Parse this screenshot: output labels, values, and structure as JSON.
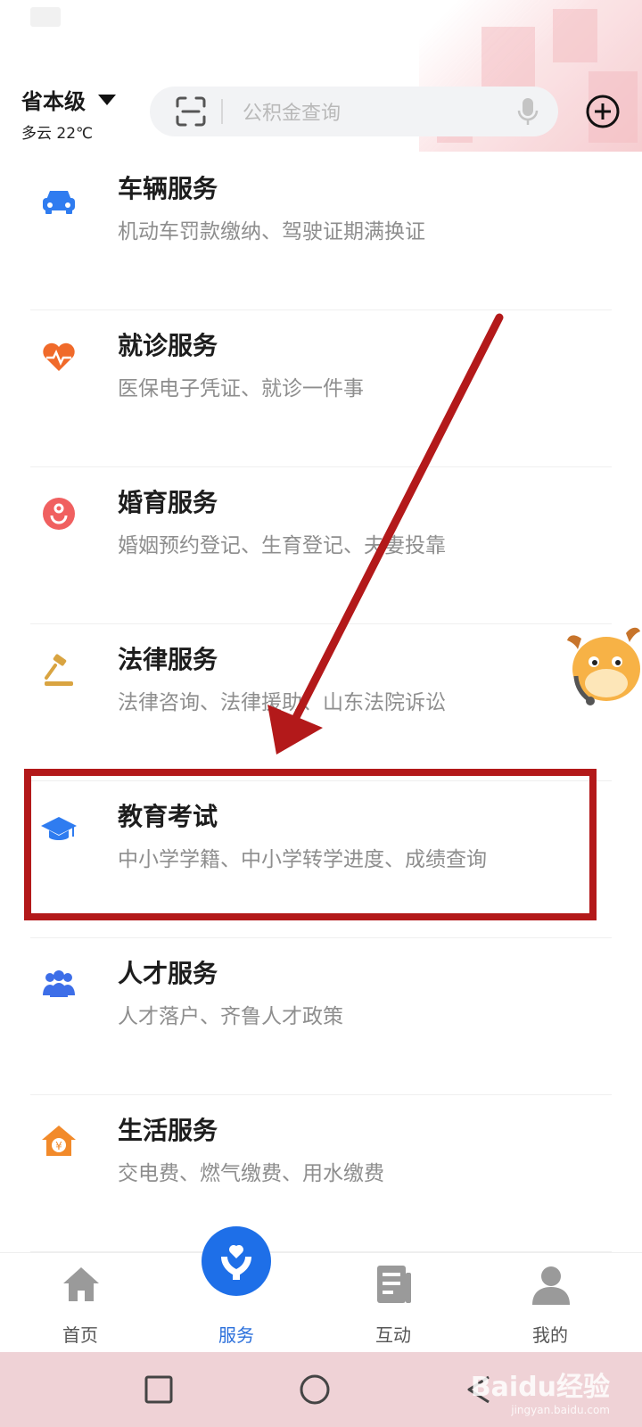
{
  "header": {
    "region": "省本级",
    "weather": "多云 22℃",
    "search_placeholder": "公积金查询"
  },
  "services": [
    {
      "title": "车辆服务",
      "desc": "机动车罚款缴纳、驾驶证期满换证",
      "icon": "car-icon",
      "color": "#2f7cf0"
    },
    {
      "title": "就诊服务",
      "desc": "医保电子凭证、就诊一件事",
      "icon": "heart-pulse-icon",
      "color": "#f06a2a"
    },
    {
      "title": "婚育服务",
      "desc": "婚姻预约登记、生育登记、夫妻投靠",
      "icon": "marriage-icon",
      "color": "#f06060"
    },
    {
      "title": "法律服务",
      "desc": "法律咨询、法律援助、山东法院诉讼",
      "icon": "gavel-icon",
      "color": "#d9a441"
    },
    {
      "title": "教育考试",
      "desc": "中小学学籍、中小学转学进度、成绩查询",
      "icon": "graduation-cap-icon",
      "color": "#2f7cf0"
    },
    {
      "title": "人才服务",
      "desc": "人才落户、齐鲁人才政策",
      "icon": "people-icon",
      "color": "#3d6ee8"
    },
    {
      "title": "生活服务",
      "desc": "交电费、燃气缴费、用水缴费",
      "icon": "house-yen-icon",
      "color": "#f28a2a"
    }
  ],
  "tabbar": [
    {
      "label": "首页",
      "icon": "home-icon",
      "active": false
    },
    {
      "label": "服务",
      "icon": "service-heart-icon",
      "active": true
    },
    {
      "label": "互动",
      "icon": "document-icon",
      "active": false
    },
    {
      "label": "我的",
      "icon": "user-icon",
      "active": false
    }
  ],
  "watermark": {
    "main": "Baidu经验",
    "sub": "jingyan.baidu.com"
  },
  "colors": {
    "accent": "#1e6fe8",
    "highlight": "#b3191a",
    "annotation": "#b3191a"
  }
}
